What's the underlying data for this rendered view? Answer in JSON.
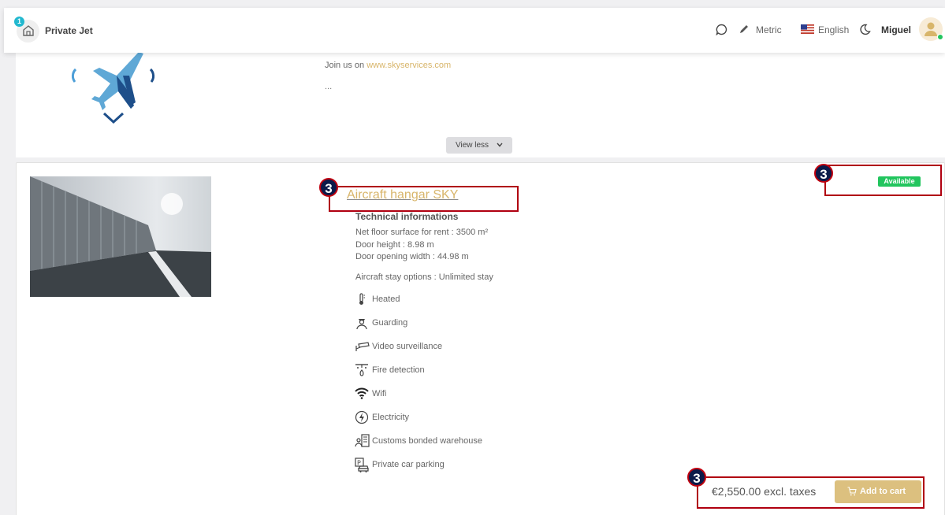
{
  "header": {
    "notifications_count": "1",
    "brand": "Private Jet",
    "units": "Metric",
    "language": "English",
    "user": "Miguel"
  },
  "intro": {
    "join_text": "Join us on ",
    "join_link": "www.skyservices.com",
    "ellipsis": "...",
    "view_less": "View less"
  },
  "listing": {
    "title": "Aircraft hangar SKY",
    "status": "Available",
    "tech_heading": "Technical informations",
    "specs": [
      "Net floor surface for rent : 3500 m²",
      "Door height : 8.98 m",
      "Door opening width : 44.98 m"
    ],
    "stay_options": "Aircraft stay options : Unlimited stay",
    "features": [
      {
        "label": "Heated",
        "icon": "thermometer-icon"
      },
      {
        "label": "Guarding",
        "icon": "guard-icon"
      },
      {
        "label": "Video surveillance",
        "icon": "camera-icon"
      },
      {
        "label": "Fire detection",
        "icon": "fire-detector-icon"
      },
      {
        "label": "Wifi",
        "icon": "wifi-icon"
      },
      {
        "label": "Electricity",
        "icon": "electricity-icon"
      },
      {
        "label": "Customs bonded warehouse",
        "icon": "customs-icon"
      },
      {
        "label": "Private car parking",
        "icon": "parking-icon"
      }
    ],
    "price": "€2,550.00 excl. taxes",
    "add_to_cart": "Add to cart"
  },
  "annotations": [
    "3",
    "3",
    "3"
  ],
  "colors": {
    "accent": "#d8b56a",
    "button": "#dcc07f",
    "available": "#22c55e",
    "annotation": "#b00010"
  }
}
